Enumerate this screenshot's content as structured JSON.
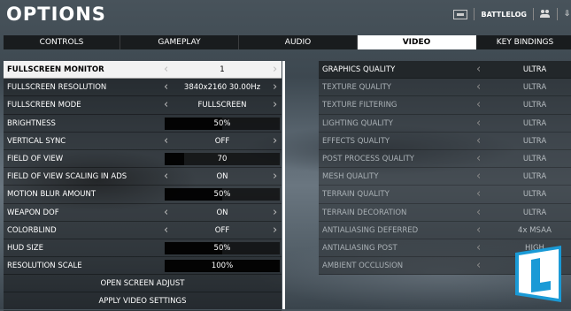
{
  "title": "OPTIONS",
  "topbar": {
    "battlelog_label": "BATTLELOG"
  },
  "tabs": [
    "CONTROLS",
    "GAMEPLAY",
    "AUDIO",
    "VIDEO",
    "KEY BINDINGS"
  ],
  "active_tab": "VIDEO",
  "left_settings": [
    {
      "label": "FULLSCREEN MONITOR",
      "value": "1",
      "type": "selector",
      "selected": true
    },
    {
      "label": "FULLSCREEN RESOLUTION",
      "value": "3840x2160 30.00Hz",
      "type": "selector"
    },
    {
      "label": "FULLSCREEN MODE",
      "value": "FULLSCREEN",
      "type": "selector"
    },
    {
      "label": "BRIGHTNESS",
      "value": "50%",
      "type": "slider",
      "level": 0.5
    },
    {
      "label": "VERTICAL SYNC",
      "value": "OFF",
      "type": "selector"
    },
    {
      "label": "FIELD OF VIEW",
      "value": "70",
      "type": "slider",
      "level": 0.17
    },
    {
      "label": "FIELD OF VIEW SCALING IN ADS",
      "value": "ON",
      "type": "selector"
    },
    {
      "label": "MOTION BLUR AMOUNT",
      "value": "50%",
      "type": "slider",
      "level": 0.5
    },
    {
      "label": "WEAPON DOF",
      "value": "ON",
      "type": "selector"
    },
    {
      "label": "COLORBLIND",
      "value": "OFF",
      "type": "selector"
    },
    {
      "label": "HUD SIZE",
      "value": "50%",
      "type": "slider",
      "level": 0.5
    },
    {
      "label": "RESOLUTION SCALE",
      "value": "100%",
      "type": "slider",
      "level": 1.0
    }
  ],
  "buttons": {
    "open_screen_adjust": "OPEN SCREEN ADJUST",
    "apply_video_settings": "APPLY VIDEO SETTINGS"
  },
  "right_settings": [
    {
      "label": "GRAPHICS QUALITY",
      "value": "ULTRA",
      "dim": false
    },
    {
      "label": "TEXTURE QUALITY",
      "value": "ULTRA",
      "dim": true
    },
    {
      "label": "TEXTURE FILTERING",
      "value": "ULTRA",
      "dim": true
    },
    {
      "label": "LIGHTING QUALITY",
      "value": "ULTRA",
      "dim": true
    },
    {
      "label": "EFFECTS QUALITY",
      "value": "ULTRA",
      "dim": true
    },
    {
      "label": "POST PROCESS QUALITY",
      "value": "ULTRA",
      "dim": true
    },
    {
      "label": "MESH QUALITY",
      "value": "ULTRA",
      "dim": true
    },
    {
      "label": "TERRAIN QUALITY",
      "value": "ULTRA",
      "dim": true
    },
    {
      "label": "TERRAIN DECORATION",
      "value": "ULTRA",
      "dim": true
    },
    {
      "label": "ANTIALIASING DEFERRED",
      "value": "4x MSAA",
      "dim": true
    },
    {
      "label": "ANTIALIASING POST",
      "value": "HIGH",
      "dim": true
    },
    {
      "label": "AMBIENT OCCLUSION",
      "value": "",
      "dim": true
    }
  ],
  "icons": {
    "arrow_left": "‹",
    "arrow_right": "›"
  },
  "colors": {
    "selected_row": "#f2f2f2",
    "active_tab": "#ffffff",
    "watermark": "#1a9ad6"
  }
}
